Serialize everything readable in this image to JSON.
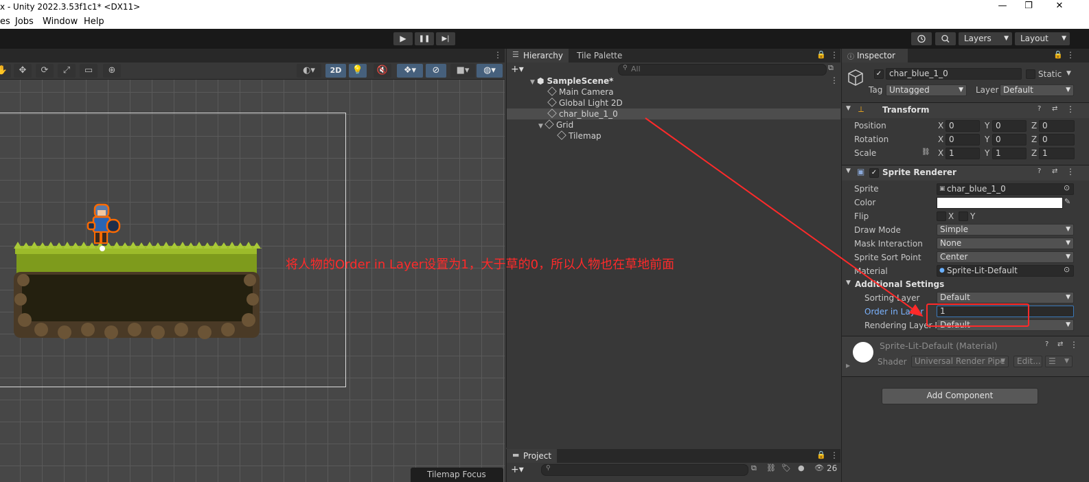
{
  "window": {
    "title": "x - Unity 2022.3.53f1c1* <DX11>",
    "controls": {
      "minimize": "—",
      "maximize": "❐",
      "close": "✕"
    }
  },
  "menu": [
    "es",
    "Jobs",
    "Window",
    "Help"
  ],
  "toolbar": {
    "play": "▶",
    "pause": "❚❚",
    "step": "▶|",
    "layers": "Layers",
    "layout": "Layout"
  },
  "scene": {
    "toggle_2d": "2D",
    "annotation": "将人物的Order in Layer设置为1，大于草的0，所以人物也在草地前面",
    "tilemap_focus": "Tilemap Focus"
  },
  "hierarchy": {
    "tabs": [
      "Hierarchy",
      "Tile Palette"
    ],
    "search_placeholder": "All",
    "scene_name": "SampleScene*",
    "items": [
      "Main Camera",
      "Global Light 2D",
      "char_blue_1_0",
      "Grid",
      "Tilemap"
    ]
  },
  "project": {
    "tab": "Project",
    "count": "26"
  },
  "inspector": {
    "tab": "Inspector",
    "object_name": "char_blue_1_0",
    "static_label": "Static",
    "tag_label": "Tag",
    "tag_value": "Untagged",
    "layer_label": "Layer",
    "layer_value": "Default",
    "transform": {
      "title": "Transform",
      "rows": [
        {
          "label": "Position",
          "x": "0",
          "y": "0",
          "z": "0"
        },
        {
          "label": "Rotation",
          "x": "0",
          "y": "0",
          "z": "0"
        },
        {
          "label": "Scale",
          "x": "1",
          "y": "1",
          "z": "1"
        }
      ],
      "axis": [
        "X",
        "Y",
        "Z"
      ]
    },
    "sprite_renderer": {
      "title": "Sprite Renderer",
      "sprite_label": "Sprite",
      "sprite_value": "char_blue_1_0",
      "color_label": "Color",
      "flip_label": "Flip",
      "flip_x": "X",
      "flip_y": "Y",
      "draw_mode_label": "Draw Mode",
      "draw_mode_value": "Simple",
      "mask_label": "Mask Interaction",
      "mask_value": "None",
      "sort_point_label": "Sprite Sort Point",
      "sort_point_value": "Center",
      "material_label": "Material",
      "material_value": "Sprite-Lit-Default",
      "additional_label": "Additional Settings",
      "sorting_layer_label": "Sorting Layer",
      "sorting_layer_value": "Default",
      "order_label": "Order in Layer",
      "order_value": "1",
      "rendering_mask_label": "Rendering Layer M",
      "rendering_mask_value": "Default"
    },
    "material": {
      "title": "Sprite-Lit-Default (Material)",
      "shader_label": "Shader",
      "shader_value": "Universal Render Pipe",
      "edit_label": "Edit..."
    },
    "add_component": "Add Component"
  }
}
